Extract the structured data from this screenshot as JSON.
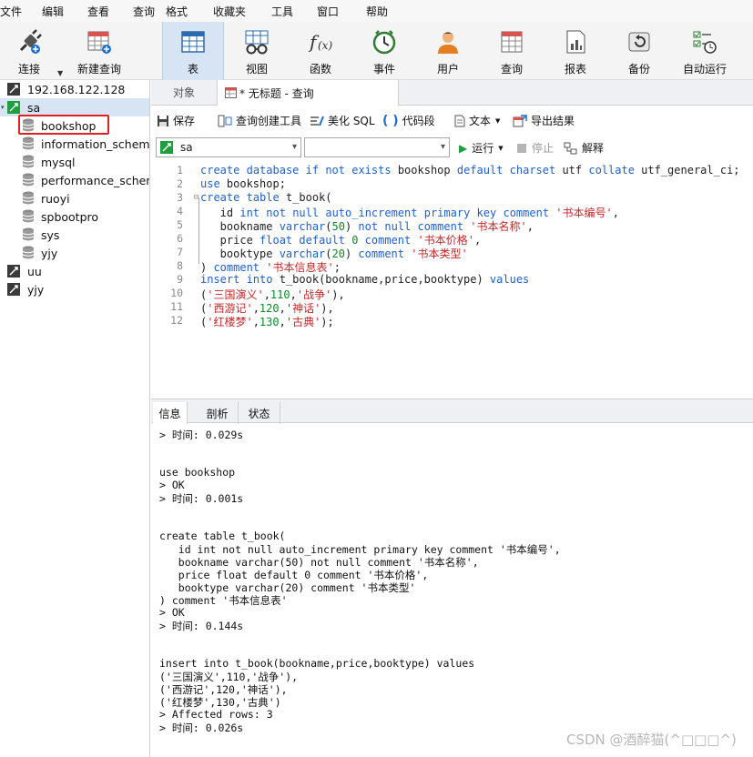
{
  "menu": [
    "文件",
    "编辑",
    "查看",
    "查询",
    "格式",
    "收藏夹",
    "工具",
    "窗口",
    "帮助"
  ],
  "toolbar": {
    "connect": "连接",
    "new_query": "新建查询",
    "table": "表",
    "view": "视图",
    "function": "函数",
    "event": "事件",
    "user": "用户",
    "query": "查询",
    "report": "报表",
    "backup": "备份",
    "automation": "自动运行"
  },
  "sidebar": {
    "server": "192.168.122.128",
    "connections": [
      {
        "name": "sa",
        "databases": [
          "bookshop",
          "information_schema",
          "mysql",
          "performance_schema",
          "ruoyi",
          "spbootpro",
          "sys",
          "yjy"
        ]
      },
      {
        "name": "uu"
      },
      {
        "name": "yjy"
      }
    ]
  },
  "tabs": {
    "objects": "对象",
    "query_tab": "* 无标题 - 查询"
  },
  "query_toolbar": {
    "save": "保存",
    "builder": "查询创建工具",
    "beautify": "美化 SQL",
    "snippet": "代码段",
    "text": "文本",
    "export": "导出结果"
  },
  "selectors": {
    "connection": "sa",
    "database": "",
    "run": "运行",
    "stop": "停止",
    "explain": "解释"
  },
  "editor": {
    "line_numbers": [
      "1",
      "2",
      "3",
      "4",
      "5",
      "6",
      "7",
      "8",
      "9",
      "10",
      "11",
      "12"
    ],
    "lines": [
      "create database if not exists bookshop default charset utf8 collate utf8_general_ci;",
      "use bookshop;",
      "create table t_book(",
      "   id int not null auto_increment primary key comment '书本编号',",
      "   bookname varchar(50) not null comment '书本名称',",
      "   price float default 0 comment '书本价格',",
      "   booktype varchar(20) comment '书本类型'",
      ") comment '书本信息表';",
      "insert into t_book(bookname,price,booktype) values",
      "('三国演义',110,'战争'),",
      "('西游记',120,'神话'),",
      "('红楼梦',130,'古典');"
    ]
  },
  "result_tabs": [
    "信息",
    "剖析",
    "状态"
  ],
  "log_lines": [
    "> 时间: 0.029s",
    "",
    "",
    "use bookshop",
    "> OK",
    "> 时间: 0.001s",
    "",
    "",
    "create table t_book(",
    "   id int not null auto_increment primary key comment '书本编号',",
    "   bookname varchar(50) not null comment '书本名称',",
    "   price float default 0 comment '书本价格',",
    "   booktype varchar(20) comment '书本类型'",
    ") comment '书本信息表'",
    "> OK",
    "> 时间: 0.144s",
    "",
    "",
    "insert into t_book(bookname,price,booktype) values",
    "('三国演义',110,'战争'),",
    "('西游记',120,'神话'),",
    "('红楼梦',130,'古典')",
    "> Affected rows: 3",
    "> 时间: 0.026s"
  ],
  "watermark": "CSDN @酒醉猫(^□□□^)",
  "colors": {
    "keyword": "#1f5fcf",
    "string": "#c62828",
    "number": "#0a8a2a",
    "selection": "#d6e4f3",
    "highlight": "#e02020"
  }
}
